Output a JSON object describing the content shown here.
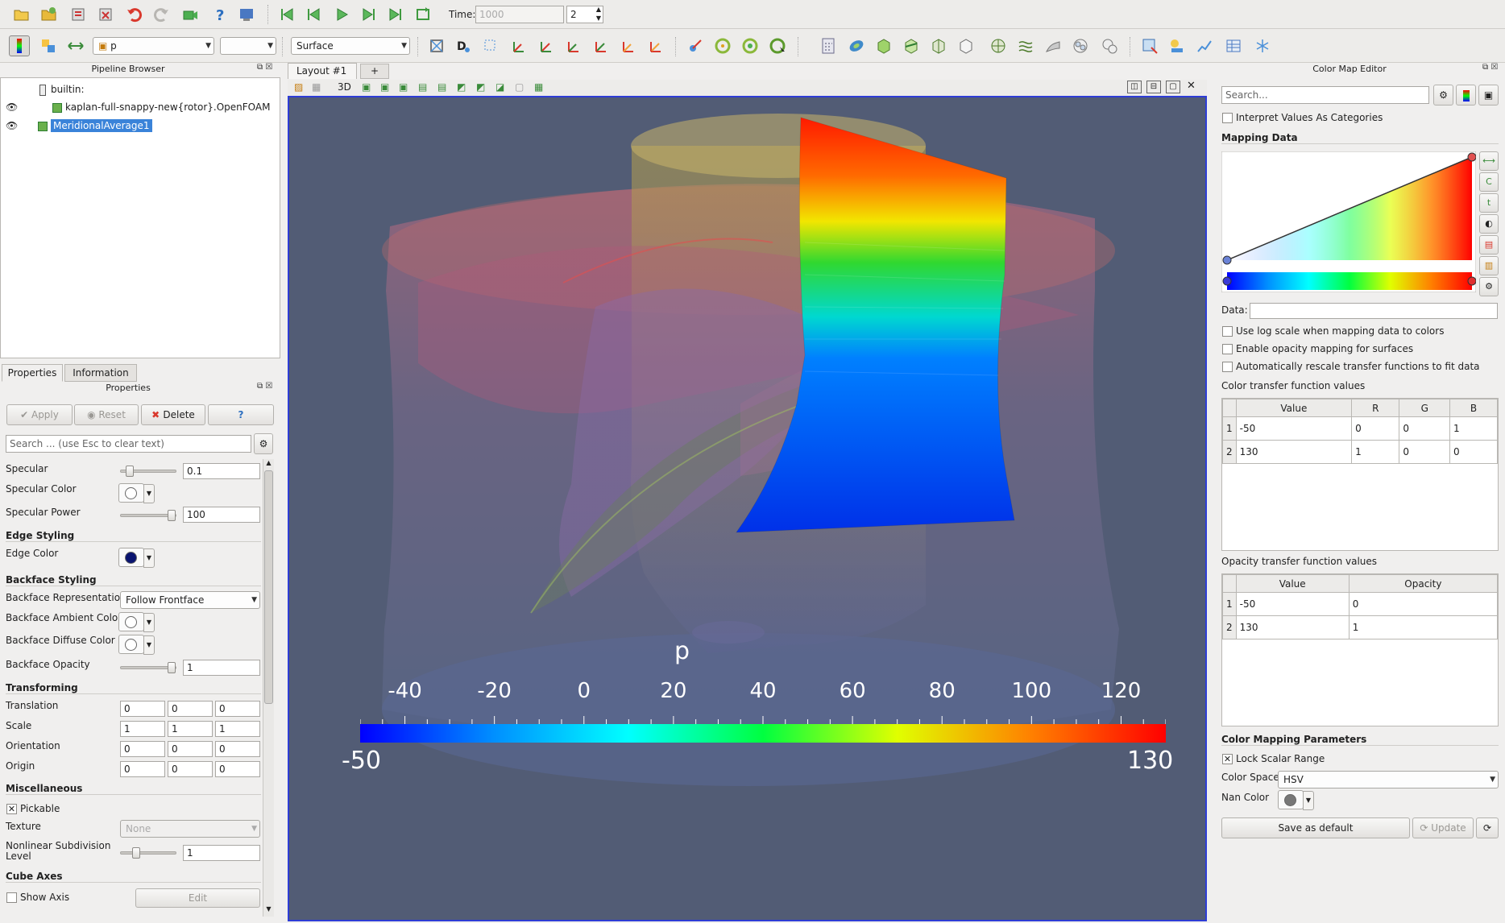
{
  "toolbar": {
    "time_label": "Time:",
    "time_value": "1000",
    "timestep": "2",
    "array_name": "p",
    "component": "",
    "representation": "Surface"
  },
  "pipeline": {
    "title": "Pipeline Browser",
    "items": [
      {
        "label": "builtin:"
      },
      {
        "label": "kaplan-full-snappy-new{rotor}.OpenFOAM"
      },
      {
        "label": "MeridionalAverage1"
      }
    ]
  },
  "properties_tabs": [
    "Properties",
    "Information"
  ],
  "properties": {
    "title": "Properties",
    "apply": "Apply",
    "reset": "Reset",
    "delete": "Delete",
    "help": "?",
    "search_placeholder": "Search ... (use Esc to clear text)",
    "specular_label": "Specular",
    "specular_value": "0.1",
    "specular_color_label": "Specular Color",
    "specular_power_label": "Specular Power",
    "specular_power_value": "100",
    "edge_styling": "Edge Styling",
    "edge_color_label": "Edge Color",
    "backface_styling": "Backface Styling",
    "backface_rep_label": "Backface Representation",
    "backface_rep_value": "Follow Frontface",
    "backface_ambient_label": "Backface Ambient Color",
    "backface_diffuse_label": "Backface Diffuse Color",
    "backface_opacity_label": "Backface Opacity",
    "backface_opacity_value": "1",
    "transforming": "Transforming",
    "translation_label": "Translation",
    "translation": [
      "0",
      "0",
      "0"
    ],
    "scale_label": "Scale",
    "scale": [
      "1",
      "1",
      "1"
    ],
    "orientation_label": "Orientation",
    "orientation": [
      "0",
      "0",
      "0"
    ],
    "origin_label": "Origin",
    "origin": [
      "0",
      "0",
      "0"
    ],
    "miscellaneous": "Miscellaneous",
    "pickable_label": "Pickable",
    "texture_label": "Texture",
    "texture_value": "None",
    "nonlinear_label_1": "Nonlinear Subdivision",
    "nonlinear_label_2": "Level",
    "nonlinear_value": "1",
    "cube_axes": "Cube Axes",
    "show_axis_label": "Show Axis",
    "edit": "Edit"
  },
  "layout": {
    "tab_label": "Layout #1",
    "add_tab": "+",
    "view_mode": "3D"
  },
  "view": {
    "scalar_bar": {
      "title": "p",
      "ticks": [
        "-40",
        "-20",
        "0",
        "20",
        "40",
        "60",
        "80",
        "100",
        "120"
      ],
      "tick_values": [
        -40,
        -20,
        0,
        20,
        40,
        60,
        80,
        100,
        120
      ],
      "range": [
        -50,
        130
      ],
      "min_label": "-50",
      "max_label": "130"
    }
  },
  "color_map_editor": {
    "title": "Color Map Editor",
    "search_placeholder": "Search...",
    "interpret_categories": "Interpret Values As Categories",
    "mapping_data": "Mapping Data",
    "data_label": "Data:",
    "log_scale": "Use log scale when mapping data to colors",
    "opacity_mapping": "Enable opacity mapping for surfaces",
    "auto_rescale": "Automatically rescale transfer functions to fit data",
    "ctf_title": "Color transfer function values",
    "ctf_headers": [
      "Value",
      "R",
      "G",
      "B"
    ],
    "ctf_rows": [
      {
        "idx": "1",
        "value": "-50",
        "r": "0",
        "g": "0",
        "b": "1"
      },
      {
        "idx": "2",
        "value": "130",
        "r": "1",
        "g": "0",
        "b": "0"
      }
    ],
    "otf_title": "Opacity transfer function values",
    "otf_headers": [
      "Value",
      "Opacity"
    ],
    "otf_rows": [
      {
        "idx": "1",
        "value": "-50",
        "opacity": "0"
      },
      {
        "idx": "2",
        "value": "130",
        "opacity": "1"
      }
    ],
    "params_title": "Color Mapping Parameters",
    "lock_range": "Lock Scalar Range",
    "color_space_label": "Color Space",
    "color_space_value": "HSV",
    "nan_color_label": "Nan Color",
    "save_default": "Save as default",
    "update": "Update"
  },
  "colors": {
    "viewport_bg": "#525c75",
    "accent": "#2e3dd6",
    "selection": "#3a83d9"
  }
}
